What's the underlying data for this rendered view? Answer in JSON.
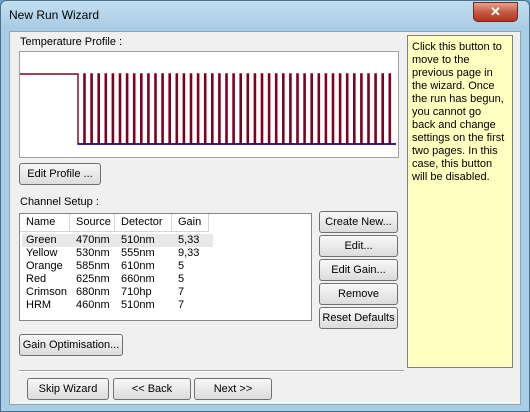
{
  "window": {
    "title": "New Run Wizard",
    "close_glyph": "✕"
  },
  "temperature_profile": {
    "label": "Temperature Profile :",
    "edit_button": "Edit Profile ...",
    "trace_color": "#800020",
    "baseline_color": "#0000a0"
  },
  "help_text": "Click this button to move to the previous page in the wizard. Once the run has begun, you cannot go back and change settings on the first two pages. In this case, this button will be disabled.",
  "channel_setup": {
    "label": "Channel Setup :",
    "columns": [
      "Name",
      "Source",
      "Detector",
      "Gain"
    ],
    "rows": [
      {
        "name": "Green",
        "source": "470nm",
        "detector": "510nm",
        "gain": "5,33"
      },
      {
        "name": "Yellow",
        "source": "530nm",
        "detector": "555nm",
        "gain": "9,33"
      },
      {
        "name": "Orange",
        "source": "585nm",
        "detector": "610nm",
        "gain": "5"
      },
      {
        "name": "Red",
        "source": "625nm",
        "detector": "660nm",
        "gain": "5"
      },
      {
        "name": "Crimson",
        "source": "680nm",
        "detector": "710hp",
        "gain": "7"
      },
      {
        "name": "HRM",
        "source": "460nm",
        "detector": "510nm",
        "gain": "7"
      }
    ],
    "buttons": {
      "create_new": "Create New...",
      "edit": "Edit...",
      "edit_gain": "Edit Gain...",
      "remove": "Remove",
      "reset_defaults": "Reset Defaults"
    },
    "gain_optimisation": "Gain Optimisation..."
  },
  "footer": {
    "skip_wizard": "Skip Wizard",
    "back": "<< Back",
    "next": "Next >>"
  }
}
